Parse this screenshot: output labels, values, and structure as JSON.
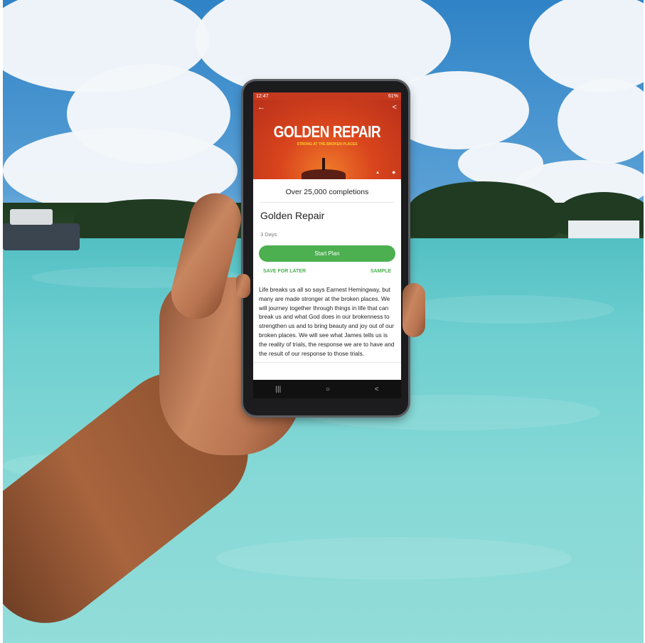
{
  "status_bar": {
    "time": "12:47",
    "battery": "61%"
  },
  "hero": {
    "title": "GOLDEN REPAIR",
    "subtitle": "STRONG AT THE BROKEN PLACES"
  },
  "plan": {
    "completions": "Over 25,000 completions",
    "title": "Golden Repair",
    "duration": "3 Days",
    "start_label": "Start Plan",
    "save_label": "SAVE FOR LATER",
    "sample_label": "SAMPLE",
    "description": "Life breaks us all so says Earnest Hemingway, but many are made stronger at the broken places. We will journey together through things in life that can break us and what God does in our brokenness to strengthen us and to bring beauty and joy out of our broken places. We will see what James tells us is the reality of trials, the response we are to have and the result of our response to those trials."
  },
  "icons": {
    "back": "back-arrow-icon",
    "share": "share-icon",
    "recents": "recents-icon",
    "home": "home-icon",
    "nav_back": "nav-back-icon"
  },
  "colors": {
    "accent": "#4caf50",
    "hero": "#d9451d",
    "water": "#6fcfd0",
    "sky": "#2f83c6"
  }
}
